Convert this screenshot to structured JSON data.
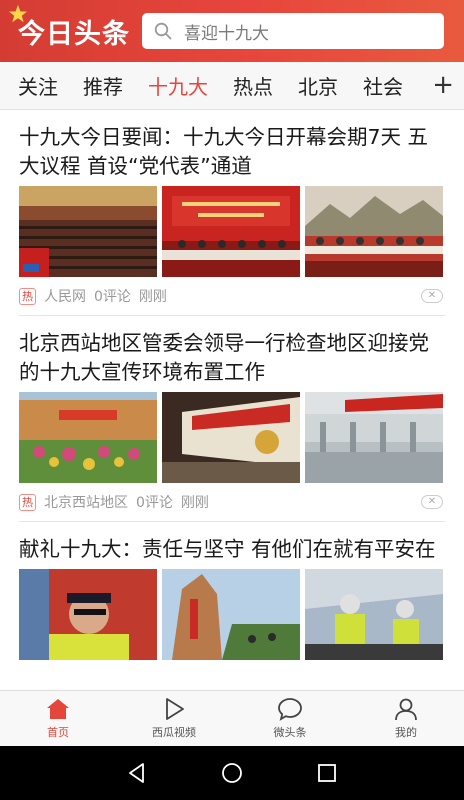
{
  "header": {
    "logo": "今日头条",
    "search_placeholder": "喜迎十九大"
  },
  "tabs": [
    {
      "label": "关注"
    },
    {
      "label": "推荐"
    },
    {
      "label": "十九大",
      "active": true
    },
    {
      "label": "热点"
    },
    {
      "label": "北京"
    },
    {
      "label": "社会"
    }
  ],
  "tab_add": "+",
  "articles": [
    {
      "title": "十九大今日要闻：十九大今日开幕会期7天 五大议程 首设“党代表”通道",
      "badge": "热",
      "source": "人民网",
      "comments": "0评论",
      "time": "刚刚"
    },
    {
      "title": "北京西站地区管委会领导一行检查地区迎接党的十九大宣传环境布置工作",
      "badge": "热",
      "source": "北京西站地区",
      "comments": "0评论",
      "time": "刚刚"
    },
    {
      "title": "献礼十九大：责任与坚守 有他们在就有平安在"
    }
  ],
  "bottom_nav": [
    {
      "label": "首页",
      "icon": "home-icon",
      "active": true
    },
    {
      "label": "西瓜视频",
      "icon": "play-icon"
    },
    {
      "label": "微头条",
      "icon": "chat-bubble-icon"
    },
    {
      "label": "我的",
      "icon": "person-icon"
    }
  ],
  "colors": {
    "brand": "#e4463c",
    "header_bg": "#d43c33"
  }
}
